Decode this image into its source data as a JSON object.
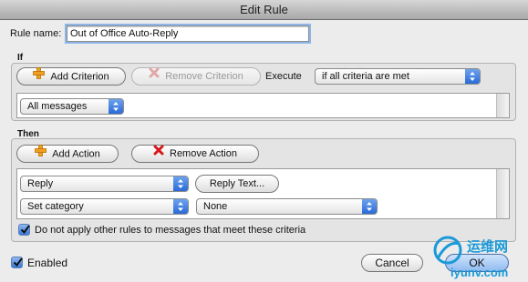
{
  "window": {
    "title": "Edit Rule"
  },
  "rule_name": {
    "label": "Rule name:",
    "value": "Out of Office Auto-Reply"
  },
  "if_section": {
    "heading": "If",
    "add_criterion_label": "Add Criterion",
    "remove_criterion_label": "Remove Criterion",
    "execute_label": "Execute",
    "execute_value": "if all criteria are met",
    "criteria": [
      {
        "value": "All messages"
      }
    ]
  },
  "then_section": {
    "heading": "Then",
    "add_action_label": "Add Action",
    "remove_action_label": "Remove Action",
    "actions": [
      {
        "value": "Reply",
        "button_label": "Reply Text..."
      },
      {
        "value": "Set category",
        "option_value": "None"
      }
    ],
    "stop_rules_label": "Do not apply other rules to messages that meet these criteria",
    "stop_rules_checked": true
  },
  "footer": {
    "enabled_label": "Enabled",
    "enabled_checked": true,
    "cancel_label": "Cancel",
    "ok_label": "OK"
  },
  "watermark": {
    "site_cn": "运维网",
    "site_url": "iyunv.com"
  },
  "colors": {
    "accent": "#3b78d6",
    "add_icon": "#f0a020",
    "remove_icon": "#d8161a",
    "watermark": "#1a9ad8"
  }
}
